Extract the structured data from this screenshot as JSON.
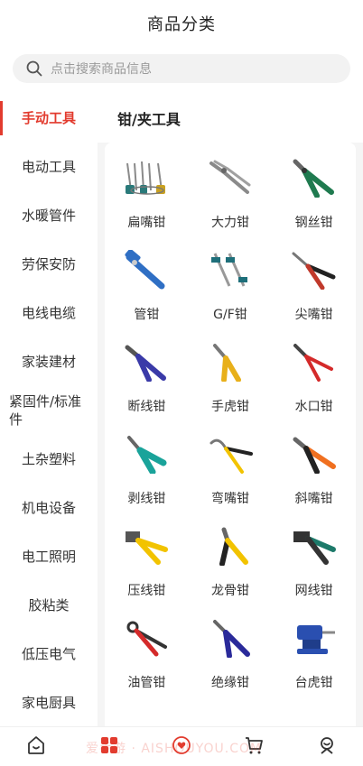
{
  "header": {
    "title": "商品分类"
  },
  "search": {
    "placeholder": "点击搜索商品信息"
  },
  "sidebar": {
    "items": [
      {
        "label": "手动工具",
        "active": true
      },
      {
        "label": "电动工具"
      },
      {
        "label": "水暖管件"
      },
      {
        "label": "劳保安防"
      },
      {
        "label": "电线电缆"
      },
      {
        "label": "家装建材"
      },
      {
        "label": "紧固件/标准件"
      },
      {
        "label": "土杂塑料"
      },
      {
        "label": "机电设备"
      },
      {
        "label": "电工照明"
      },
      {
        "label": "胶粘类"
      },
      {
        "label": "低压电气"
      },
      {
        "label": "家电厨具"
      }
    ]
  },
  "main": {
    "category_title": "钳/夹工具",
    "products": [
      {
        "label": "扁嘴钳",
        "icon": "pliers-set-icon"
      },
      {
        "label": "大力钳",
        "icon": "locking-pliers-icon"
      },
      {
        "label": "钢丝钳",
        "icon": "combination-pliers-icon"
      },
      {
        "label": "管钳",
        "icon": "pipe-wrench-icon"
      },
      {
        "label": "G/F钳",
        "icon": "f-clamp-icon"
      },
      {
        "label": "尖嘴钳",
        "icon": "needle-nose-pliers-icon"
      },
      {
        "label": "断线钳",
        "icon": "wire-cutter-icon"
      },
      {
        "label": "手虎钳",
        "icon": "hand-vise-icon"
      },
      {
        "label": "水口钳",
        "icon": "flush-cutter-icon"
      },
      {
        "label": "剥线钳",
        "icon": "wire-stripper-icon"
      },
      {
        "label": "弯嘴钳",
        "icon": "bent-nose-pliers-icon"
      },
      {
        "label": "斜嘴钳",
        "icon": "diagonal-pliers-icon"
      },
      {
        "label": "压线钳",
        "icon": "crimping-pliers-icon"
      },
      {
        "label": "龙骨钳",
        "icon": "stud-crimper-icon"
      },
      {
        "label": "网线钳",
        "icon": "network-crimper-icon"
      },
      {
        "label": "油管钳",
        "icon": "hose-pliers-icon"
      },
      {
        "label": "绝缘钳",
        "icon": "insulated-pliers-icon"
      },
      {
        "label": "台虎钳",
        "icon": "bench-vise-icon"
      }
    ]
  },
  "tabbar": {
    "items": [
      {
        "icon": "home-icon"
      },
      {
        "icon": "category-icon",
        "active": true
      },
      {
        "icon": "heart-bubble-icon"
      },
      {
        "icon": "cart-icon"
      },
      {
        "icon": "user-icon"
      }
    ]
  },
  "watermark": "爱手游 · AISHOUYOU.COM",
  "colors": {
    "accent": "#e23b2e",
    "background": "#f5f5f5"
  }
}
